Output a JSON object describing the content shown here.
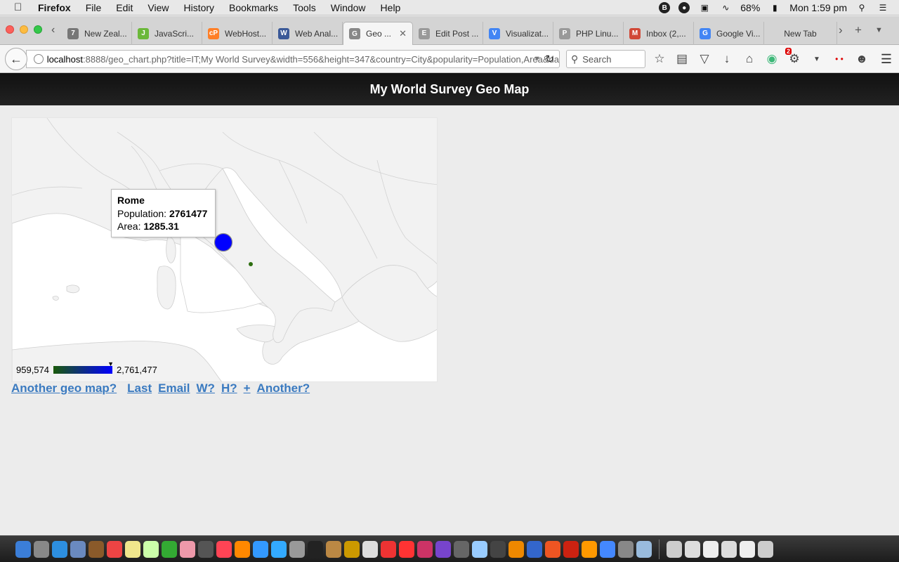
{
  "menubar": {
    "app_name": "Firefox",
    "items": [
      "File",
      "Edit",
      "View",
      "History",
      "Bookmarks",
      "Tools",
      "Window",
      "Help"
    ],
    "battery": "68%",
    "clock": "Mon 1:59 pm"
  },
  "tabs": [
    {
      "label": "New Zeal...",
      "favicon_color": "#777777",
      "favicon": "7"
    },
    {
      "label": "JavaScri...",
      "favicon_color": "#6bb83a",
      "favicon": "J"
    },
    {
      "label": "WebHost...",
      "favicon_color": "#ff7f27",
      "favicon": "cP"
    },
    {
      "label": "Web Anal...",
      "favicon_color": "#3b5998",
      "favicon": "W"
    },
    {
      "label": "Geo ...",
      "favicon_color": "#888888",
      "favicon": "G",
      "active": true
    },
    {
      "label": "Edit Post ...",
      "favicon_color": "#999999",
      "favicon": "E"
    },
    {
      "label": "Visualizat...",
      "favicon_color": "#4285f4",
      "favicon": "V"
    },
    {
      "label": "PHP Linu...",
      "favicon_color": "#999999",
      "favicon": "P"
    },
    {
      "label": "Inbox (2,...",
      "favicon_color": "#d14836",
      "favicon": "M"
    },
    {
      "label": "Google Vi...",
      "favicon_color": "#4285f4",
      "favicon": "G"
    },
    {
      "label": "New Tab",
      "favicon_color": "",
      "favicon": ""
    }
  ],
  "navbar": {
    "url_host": "localhost",
    "url_path": ":8888/geo_chart.php?title=IT;My World Survey&width=556&height=347&country=City&popularity=Population,Area&da",
    "search_placeholder": "Search",
    "notification_count": "2"
  },
  "page": {
    "header_title": "My World Survey Geo Map",
    "links": [
      "Another geo map?",
      "Last",
      "Email",
      "W?",
      "H?",
      "+",
      "Another?"
    ]
  },
  "geo_map": {
    "tooltip": {
      "city": "Rome",
      "population_label": "Population:",
      "population_value": "2761477",
      "area_label": "Area:",
      "area_value": "1285.31"
    },
    "legend": {
      "min": "959,574",
      "max": "2,761,477",
      "color_min": "#1a5a0a",
      "color_max": "#0000ff"
    },
    "markers": [
      {
        "city": "Rome",
        "population": 2761477,
        "area": 1285.31,
        "color": "#0000ff"
      },
      {
        "city": "",
        "color": "#2d6e10"
      }
    ]
  }
}
